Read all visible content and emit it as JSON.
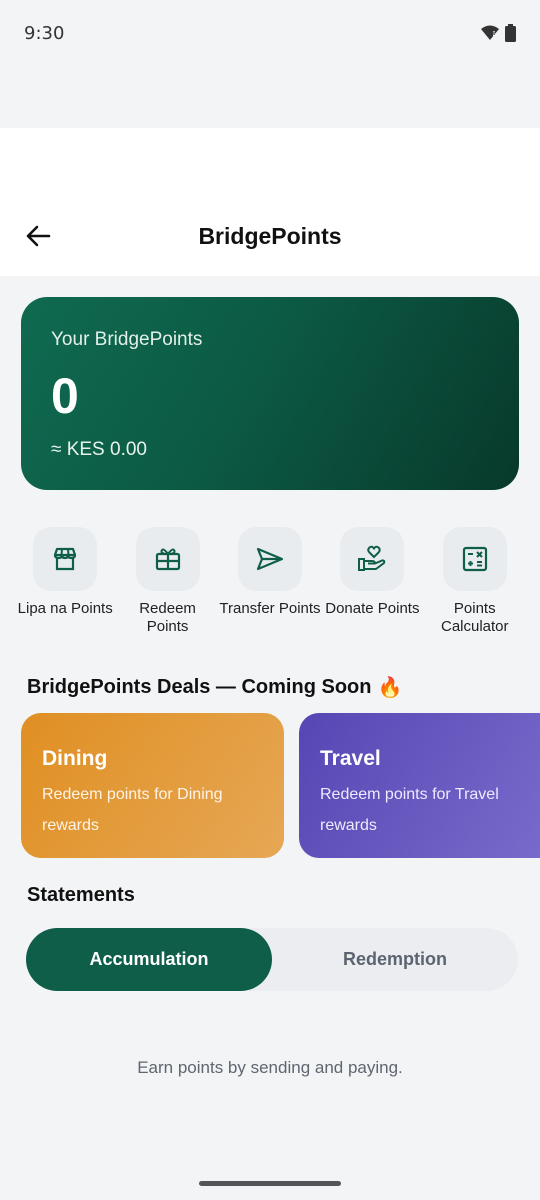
{
  "status_bar": {
    "time": "9:30"
  },
  "header": {
    "title": "BridgePoints"
  },
  "points_card": {
    "label": "Your BridgePoints",
    "value": "0",
    "kes": "≈ KES 0.00"
  },
  "actions": [
    {
      "label": "Lipa na Points",
      "icon": "store-icon"
    },
    {
      "label": "Redeem Points",
      "icon": "gift-icon"
    },
    {
      "label": "Transfer Points",
      "icon": "send-icon"
    },
    {
      "label": "Donate Points",
      "icon": "donate-heart-icon"
    },
    {
      "label": "Points Calculator",
      "icon": "calculator-icon"
    }
  ],
  "deals": {
    "title": "BridgePoints Deals — Coming Soon",
    "title_emoji": "🔥",
    "cards": [
      {
        "title": "Dining",
        "desc": "Redeem points for Dining rewards"
      },
      {
        "title": "Travel",
        "desc": "Redeem points for Travel rewards"
      }
    ]
  },
  "statements": {
    "title": "Statements",
    "tabs": [
      "Accumulation",
      "Redemption"
    ],
    "empty_text": "Earn points by sending and paying."
  },
  "colors": {
    "brand_green": "#0f5e4a",
    "dining_orange": "#e08f22",
    "travel_purple": "#5646b4"
  }
}
